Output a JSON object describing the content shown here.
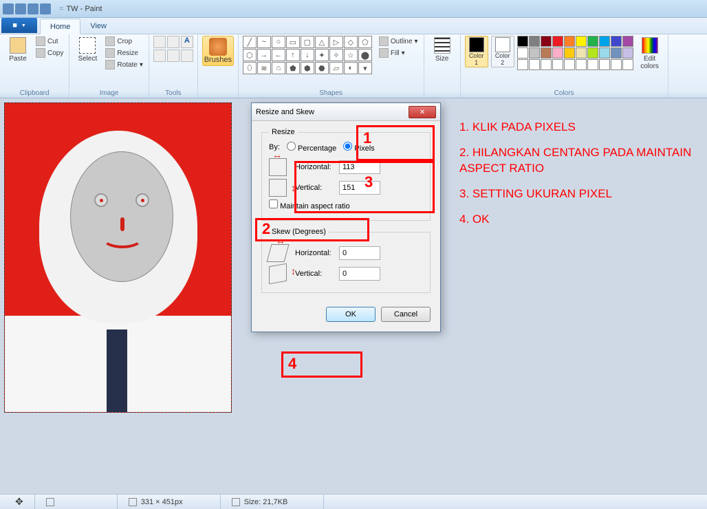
{
  "titlebar": {
    "doc": "TW",
    "app": "Paint"
  },
  "tabs": {
    "home": "Home",
    "view": "View"
  },
  "ribbon": {
    "clipboard": {
      "label": "Clipboard",
      "paste": "Paste",
      "cut": "Cut",
      "copy": "Copy"
    },
    "image": {
      "label": "Image",
      "select": "Select",
      "crop": "Crop",
      "resize": "Resize",
      "rotate": "Rotate"
    },
    "tools": {
      "label": "Tools",
      "brushes": "Brushes"
    },
    "shapes": {
      "label": "Shapes",
      "outline": "Outline",
      "fill": "Fill"
    },
    "size": {
      "label": "Size"
    },
    "colors": {
      "label": "Colors",
      "color1": "Color\n1",
      "color2": "Color\n2",
      "edit": "Edit\ncolors"
    }
  },
  "dialog": {
    "title": "Resize and Skew",
    "resize": "Resize",
    "by": "By:",
    "percentage": "Percentage",
    "pixels": "Pixels",
    "horizontal": "Horizontal:",
    "vertical": "Vertical:",
    "h_val": "113",
    "v_val": "151",
    "maintain": "Maintain aspect ratio",
    "skew": "Skew (Degrees)",
    "skew_h": "0",
    "skew_v": "0",
    "ok": "OK",
    "cancel": "Cancel"
  },
  "annotations": {
    "n1": "1",
    "n2": "2",
    "n3": "3",
    "n4": "4",
    "step1": "1. KLIK PADA PIXELS",
    "step2": "2. HILANGKAN CENTANG PADA MAINTAIN ASPECT RATIO",
    "step3": "3. SETTING UKURAN PIXEL",
    "step4": "4. OK"
  },
  "status": {
    "dims": "331 × 451px",
    "size": "Size: 21,7KB"
  },
  "palette_colors": [
    "#000",
    "#7f7f7f",
    "#880015",
    "#ed1c24",
    "#ff7f27",
    "#fff200",
    "#22b14c",
    "#00a2e8",
    "#3f48cc",
    "#a349a4",
    "#fff",
    "#c3c3c3",
    "#b97a57",
    "#ffaec9",
    "#ffc90e",
    "#efe4b0",
    "#b5e61d",
    "#99d9ea",
    "#7092be",
    "#c8bfe7"
  ]
}
